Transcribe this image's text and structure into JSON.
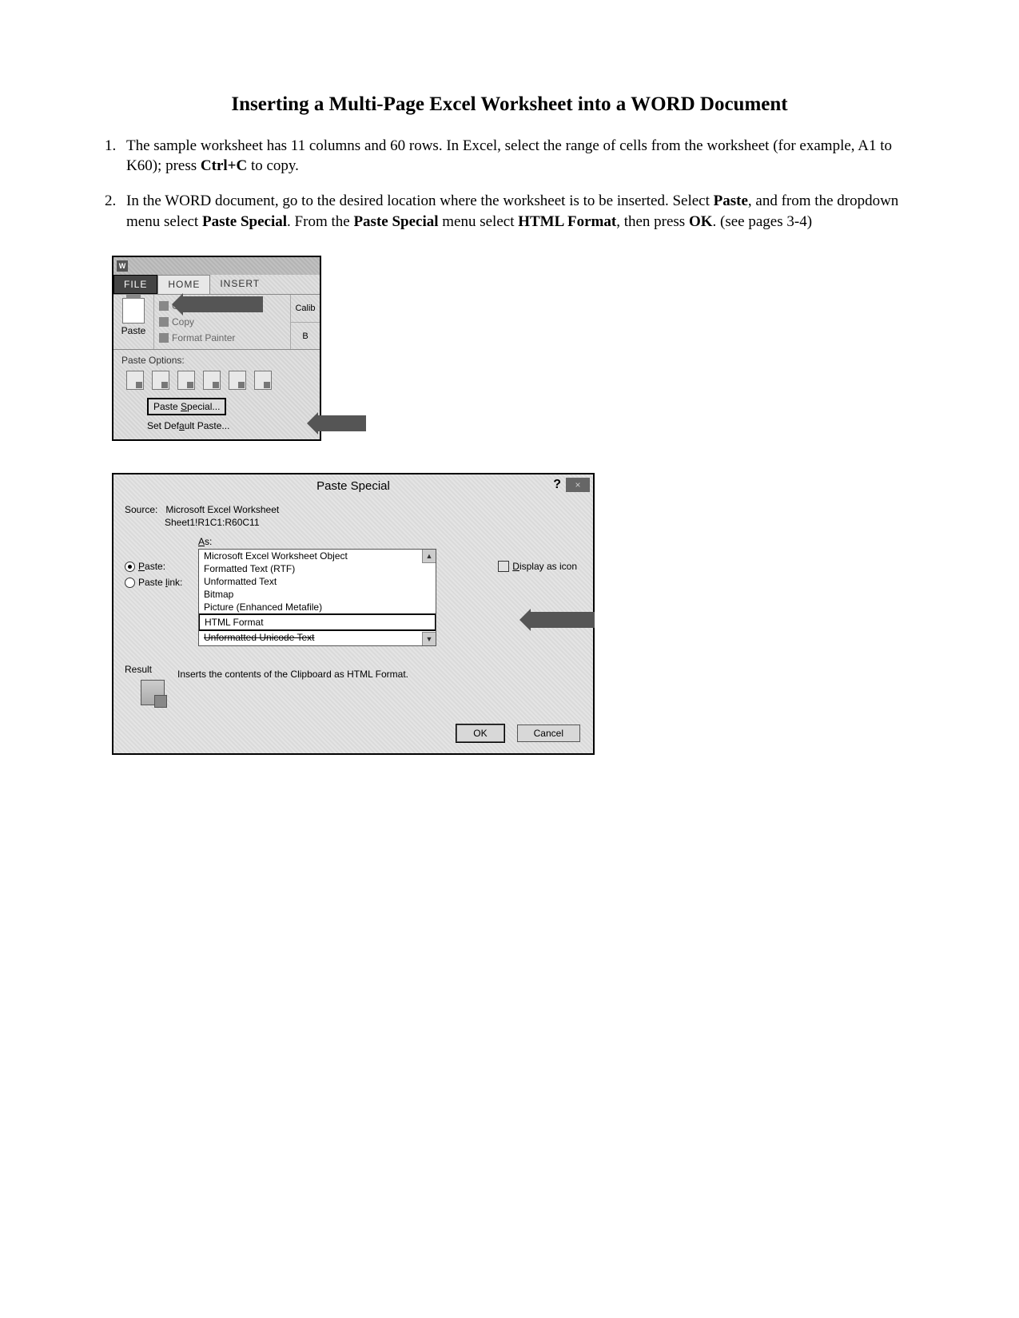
{
  "title": "Inserting a Multi-Page Excel Worksheet into a WORD Document",
  "steps": {
    "s1a": "The sample worksheet has 11 columns and 60 rows. In Excel, select the range of cells from the worksheet (for example, A1 to K60); press ",
    "s1_bold": "Ctrl+C",
    "s1b": " to copy.",
    "s2a": "In the WORD document, go to the desired location where the worksheet is to be inserted. Select ",
    "s2_b1": "Paste",
    "s2b": ", and from the dropdown menu select ",
    "s2_b2": "Paste Special",
    "s2c": ". From the ",
    "s2_b3": "Paste Special",
    "s2d": " menu select ",
    "s2_b4": "HTML Format",
    "s2e": ", then press ",
    "s2_b5": "OK",
    "s2f": ". (see pages 3-4)"
  },
  "ribbon": {
    "word_icon": "W",
    "tabs": {
      "file": "FILE",
      "home": "HOME",
      "insert": "INSERT"
    },
    "paste": "Paste",
    "cut": "Cut",
    "copy": "Copy",
    "format_painter": "Format Painter",
    "font_sample": "Calib",
    "bold_sample": "B",
    "paste_options": "Paste Options:",
    "paste_special": "Paste Special...",
    "paste_special_key": "S",
    "set_default": "Set Default Paste...",
    "set_default_key": "a"
  },
  "dialog": {
    "title": "Paste Special",
    "help": "?",
    "close": "×",
    "source_label": "Source:",
    "source_value": "Microsoft Excel Worksheet",
    "source_range": "Sheet1!R1C1:R60C11",
    "as_label": "As:",
    "as_key": "A",
    "radio_paste": "Paste:",
    "radio_paste_key": "P",
    "radio_pastelink": "Paste link:",
    "radio_pastelink_key": "l",
    "list": [
      "Microsoft Excel Worksheet Object",
      "Formatted Text (RTF)",
      "Unformatted Text",
      "Bitmap",
      "Picture (Enhanced Metafile)",
      "HTML Format",
      "Unformatted Unicode Text"
    ],
    "display_as_icon": "Display as icon",
    "display_as_icon_key": "D",
    "result_label": "Result",
    "result_text": "Inserts the contents of the Clipboard as HTML Format.",
    "ok": "OK",
    "cancel": "Cancel"
  }
}
